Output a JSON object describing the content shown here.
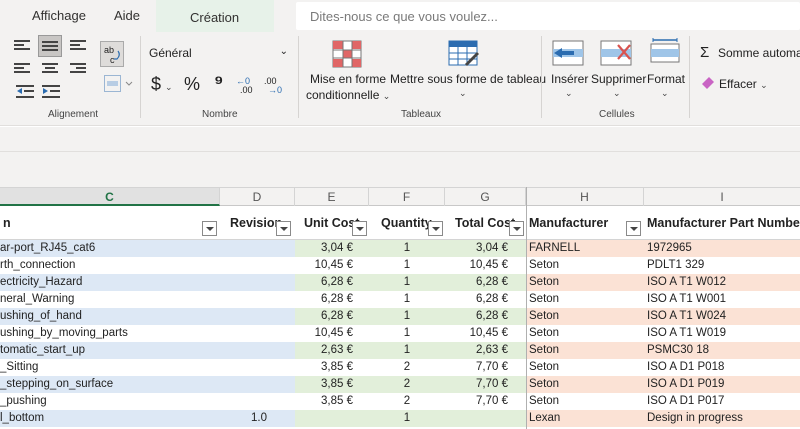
{
  "menu": {
    "tabs": [
      "Affichage",
      "Aide"
    ],
    "active_tab": "Création",
    "tell_me_placeholder": "Dites-nous ce que vous voulez..."
  },
  "ribbon": {
    "groups": {
      "alignment": "Alignement",
      "number": "Nombre",
      "tables": "Tableaux",
      "cells": "Cellules"
    },
    "number_format": "Général",
    "currency_symbol": "$",
    "percent_symbol": "%",
    "comma_symbol": "⁹",
    "dec_increase": "←0 .00",
    "dec_decrease": ".00 →0",
    "conditional_format_line1": "Mise en forme",
    "conditional_format_line2": "conditionnelle",
    "format_as_table": "Mettre sous forme de tableau",
    "insert": "Insérer",
    "delete": "Supprimer",
    "format": "Format",
    "autosum": "Somme automat",
    "clear": "Effacer"
  },
  "columns": [
    "C",
    "D",
    "E",
    "F",
    "G",
    "H",
    "I"
  ],
  "selected_column": "C",
  "table_headers": {
    "c": "n",
    "d": "Revision",
    "e": "Unit Cost",
    "f": "Quantity",
    "g": "Total Cost",
    "h": "Manufacturer",
    "i": "Manufacturer Part Number"
  },
  "rows": [
    {
      "c": "ar-port_RJ45_cat6",
      "d": "",
      "e": "3,04 €",
      "f": "1",
      "g": "3,04 €",
      "h": "FARNELL",
      "i": "1972965"
    },
    {
      "c": "rth_connection",
      "d": "",
      "e": "10,45 €",
      "f": "1",
      "g": "10,45 €",
      "h": "Seton",
      "i": "PDLT1 329"
    },
    {
      "c": "ectricity_Hazard",
      "d": "",
      "e": "6,28 €",
      "f": "1",
      "g": "6,28 €",
      "h": "Seton",
      "i": "ISO A T1 W012"
    },
    {
      "c": "neral_Warning",
      "d": "",
      "e": "6,28 €",
      "f": "1",
      "g": "6,28 €",
      "h": "Seton",
      "i": "ISO A T1 W001"
    },
    {
      "c": "ushing_of_hand",
      "d": "",
      "e": "6,28 €",
      "f": "1",
      "g": "6,28 €",
      "h": "Seton",
      "i": "ISO A T1 W024"
    },
    {
      "c": "ushing_by_moving_parts",
      "d": "",
      "e": "10,45 €",
      "f": "1",
      "g": "10,45 €",
      "h": "Seton",
      "i": "ISO A T1 W019"
    },
    {
      "c": "tomatic_start_up",
      "d": "",
      "e": "2,63 €",
      "f": "1",
      "g": "2,63 €",
      "h": "Seton",
      "i": "PSMC30 18"
    },
    {
      "c": "_Sitting",
      "d": "",
      "e": "3,85 €",
      "f": "2",
      "g": "7,70 €",
      "h": "Seton",
      "i": "ISO A D1 P018"
    },
    {
      "c": "_stepping_on_surface",
      "d": "",
      "e": "3,85 €",
      "f": "2",
      "g": "7,70 €",
      "h": "Seton",
      "i": "ISO A D1 P019"
    },
    {
      "c": "_pushing",
      "d": "",
      "e": "3,85 €",
      "f": "2",
      "g": "7,70 €",
      "h": "Seton",
      "i": "ISO A D1 P017"
    },
    {
      "c": "l_bottom",
      "d": "1.0",
      "e": "",
      "f": "1",
      "g": "",
      "h": "Lexan",
      "i": "Design in progress"
    }
  ],
  "colors": {
    "c_odd": "#dde8f5",
    "c_even": "#ffffff",
    "num_odd": "#e2efda",
    "num_even": "#ffffff",
    "h_odd": "#fbe2d5",
    "h_even": "#ffffff"
  }
}
